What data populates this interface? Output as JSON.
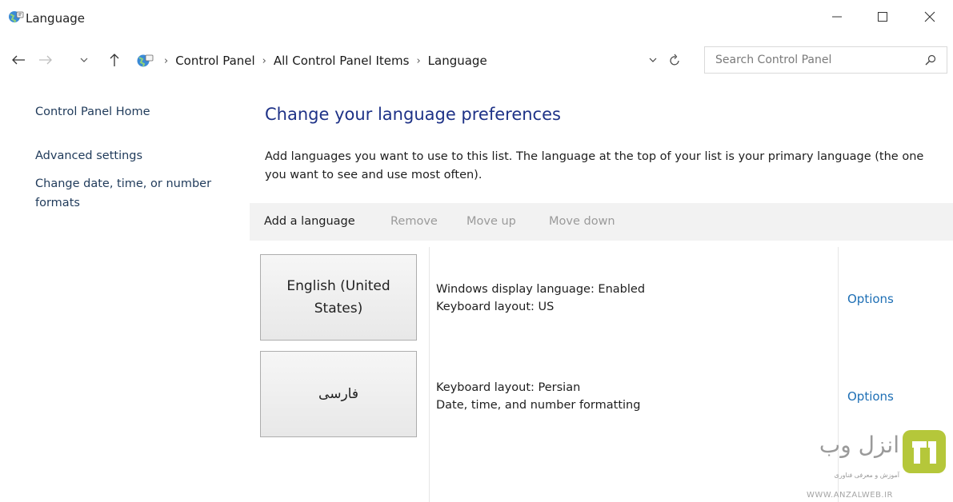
{
  "window": {
    "title": "Language",
    "icon": "language-globe-icon",
    "controls": {
      "minimize": "—",
      "maximize": "☐",
      "close": "✕"
    }
  },
  "nav": {
    "back_icon": "arrow-left-icon",
    "forward_icon": "arrow-right-icon",
    "recent_icon": "chevron-down-icon",
    "up_icon": "arrow-up-icon"
  },
  "address": {
    "segments": [
      "Control Panel",
      "All Control Panel Items",
      "Language"
    ],
    "separator": "›"
  },
  "search": {
    "placeholder": "Search Control Panel",
    "value": ""
  },
  "sidebar": {
    "items": [
      "Control Panel Home",
      "Advanced settings",
      "Change date, time, or number formats"
    ]
  },
  "main": {
    "heading": "Change your language preferences",
    "description": "Add languages you want to use to this list. The language at the top of your list is your primary language (the one you want to see and use most often).",
    "toolbar": {
      "add": "Add a language",
      "remove": "Remove",
      "move_up": "Move up",
      "move_down": "Move down"
    },
    "languages": [
      {
        "name": "English (United States)",
        "details": [
          "Windows display language: Enabled",
          "Keyboard layout: US"
        ],
        "options": "Options"
      },
      {
        "name": "فارسی",
        "details": [
          "Keyboard layout: Persian",
          "Date, time, and number formatting"
        ],
        "options": "Options"
      }
    ]
  },
  "watermark": {
    "brand": "انزل وب",
    "tagline": "آموزش و معرفی فناوری",
    "url": "WWW.ANZALWEB.IR",
    "color": "#b5c73a"
  }
}
